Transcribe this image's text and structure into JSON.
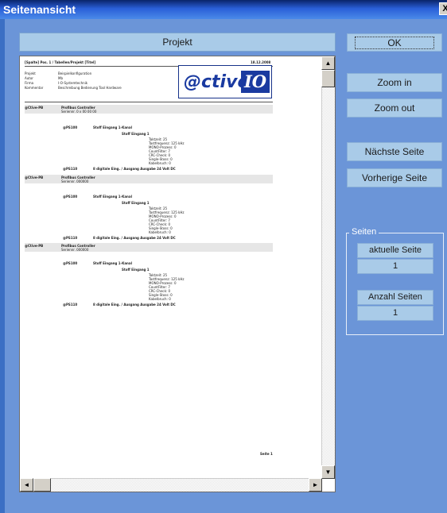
{
  "window": {
    "title": "Seitenansicht",
    "close_glyph": "X"
  },
  "header": {
    "title": "Projekt"
  },
  "preview": {
    "page_header": {
      "left": "[Spalte] Pos. 1 / Tabellen/Projekt [Titel]",
      "right": "18.12.2008"
    },
    "meta": [
      {
        "key": "Projekt",
        "value": "Beispielkonfiguration"
      },
      {
        "key": "Autor",
        "value": "Mb"
      },
      {
        "key": "Firma",
        "value": "I-O-Systemtechnik"
      },
      {
        "key": "Kommentar",
        "value": "Beschreibung Bedienung Tool Hardware"
      }
    ],
    "logo": {
      "prefix": "@ctive",
      "suffix": "IO"
    },
    "blocks": [
      {
        "head": "@Ctive-PB",
        "title": "Profibus Controller",
        "sub": "Seriennr. 0 x 00 00 00"
      },
      {
        "head": "@Ctive-PB",
        "title": "Profibus Controller",
        "sub": "Seriennr. 000000"
      },
      {
        "head": "@Ctive-PB",
        "title": "Profibus Controller",
        "sub": "Seriennr. 000000"
      }
    ],
    "rows": {
      "a_key": "@PS100",
      "a_val": "Stoff Eingang 1-Kanal",
      "b_val": "Stoff Eingang 1",
      "details": [
        "Taktzeit: 25",
        "Tastfrequenz: 125 kHz",
        "MONO-Prozess: 0",
        "CountFilter: 7",
        "CRC-Check: 0",
        "Single-Stoss: 0",
        "Kabelbruch: 0"
      ],
      "c_key": "@PS110",
      "c_val": "8 digitale Eing. / Ausgang Ausgabe 24 Volt DC"
    },
    "footer": "Seite 1"
  },
  "buttons": {
    "ok": "OK",
    "zoom_in": "Zoom in",
    "zoom_out": "Zoom out",
    "next": "Nächste Seite",
    "prev": "Vorherige Seite"
  },
  "pages_group": {
    "label": "Seiten",
    "current_label": "aktuelle Seite",
    "current_value": "1",
    "total_label": "Anzahl Seiten",
    "total_value": "1"
  },
  "scroll": {
    "up": "▲",
    "down": "▼",
    "left": "◄",
    "right": "►"
  }
}
